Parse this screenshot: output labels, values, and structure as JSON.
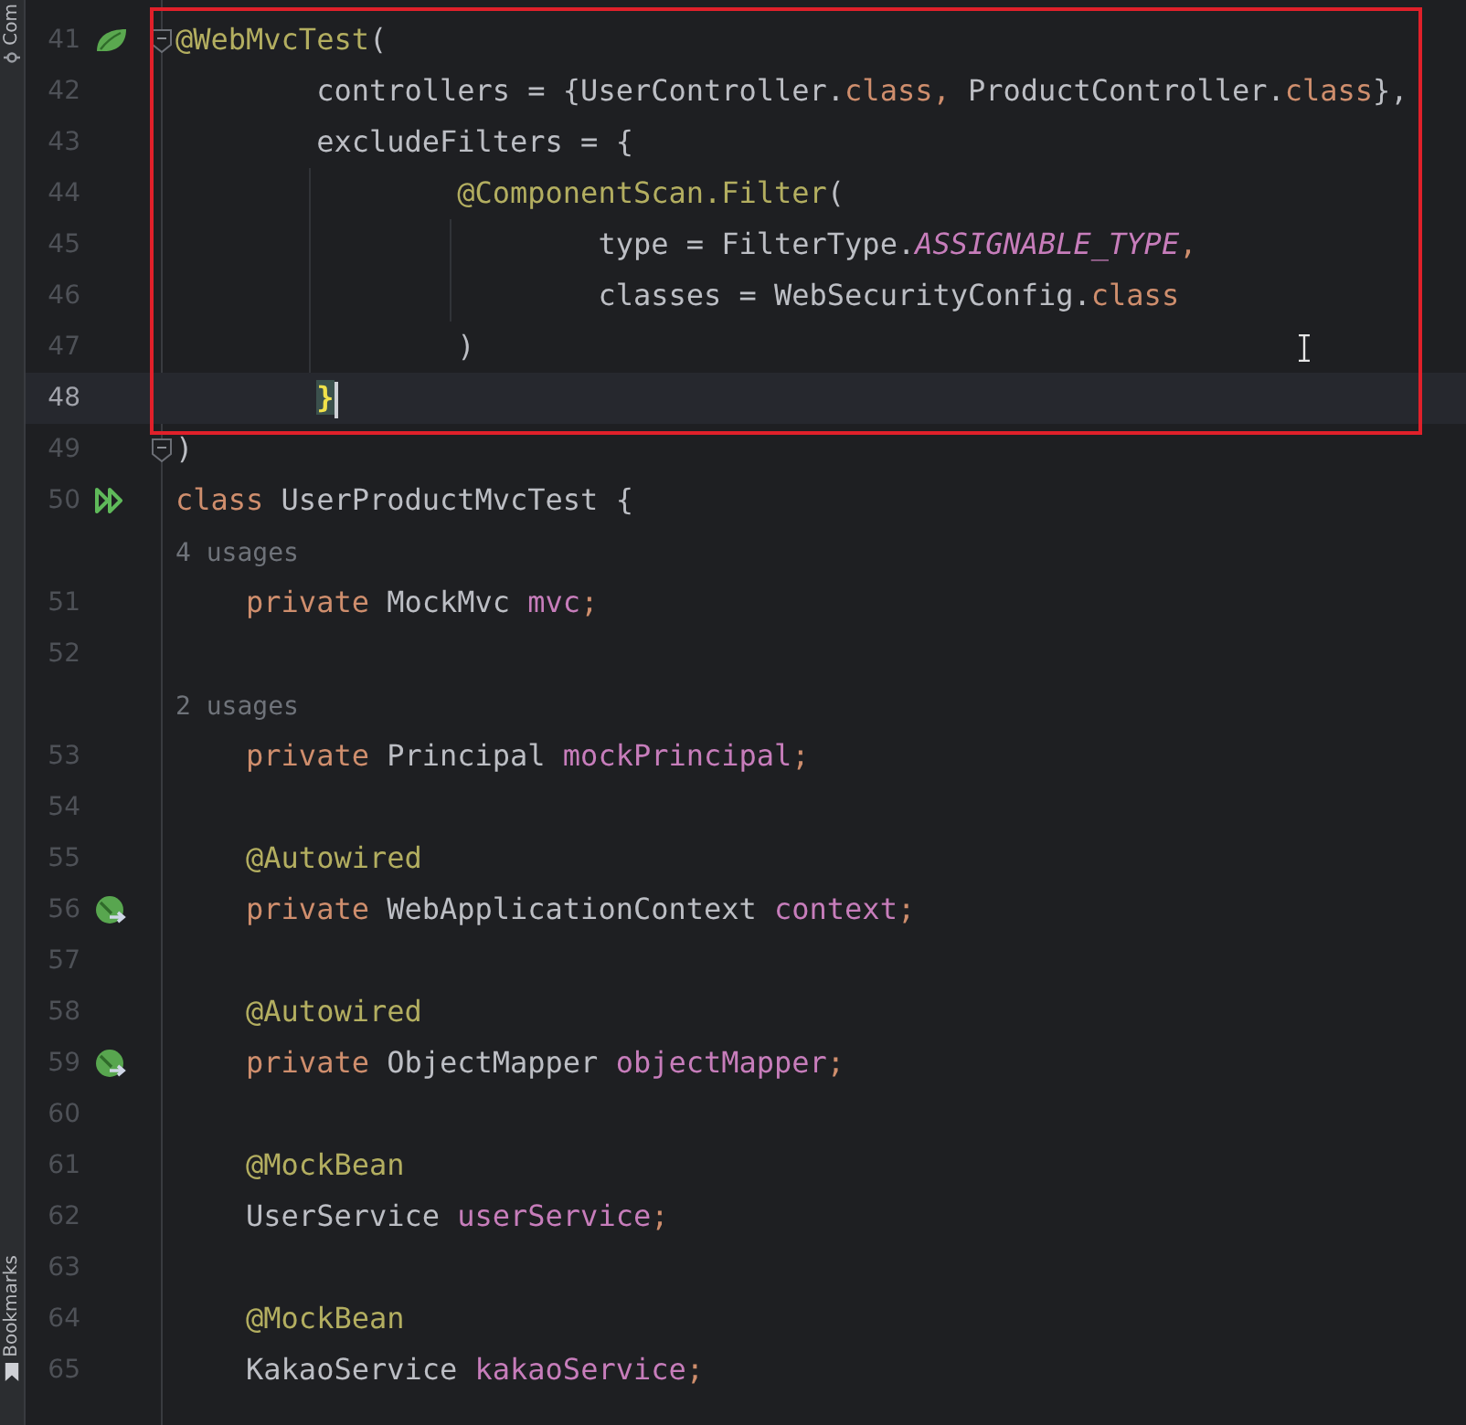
{
  "side_strip": {
    "tabs": [
      {
        "label": "Com"
      },
      {
        "label": "Bookmarks"
      }
    ]
  },
  "editor": {
    "lines": [
      {
        "kind": "code",
        "number": "41",
        "current": false,
        "fold": true,
        "gutter_icon": {
          "kind": "leaf"
        },
        "tokens": [
          {
            "t": "@WebMvcTest",
            "kind": "annotation"
          },
          {
            "t": "(",
            "kind": "plain"
          }
        ]
      },
      {
        "kind": "code",
        "number": "42",
        "current": false,
        "fold": false,
        "tokens": [
          {
            "t": "        controllers = {UserController.",
            "kind": "plain"
          },
          {
            "t": "class",
            "kind": "keyword"
          },
          {
            "t": ", ",
            "kind": "keyword"
          },
          {
            "t": "ProductController.",
            "kind": "plain"
          },
          {
            "t": "class",
            "kind": "keyword"
          },
          {
            "t": "},",
            "kind": "plain"
          }
        ]
      },
      {
        "kind": "code",
        "number": "43",
        "current": false,
        "fold": false,
        "tokens": [
          {
            "t": "        excludeFilters = ",
            "kind": "plain"
          },
          {
            "t": "{",
            "kind": "brace"
          }
        ]
      },
      {
        "kind": "code",
        "number": "44",
        "current": false,
        "fold": false,
        "tokens": [
          {
            "t": "                @ComponentScan.Filter",
            "kind": "annotation"
          },
          {
            "t": "(",
            "kind": "plain"
          }
        ]
      },
      {
        "kind": "code",
        "number": "45",
        "current": false,
        "fold": false,
        "tokens": [
          {
            "t": "                        type = FilterType.",
            "kind": "plain"
          },
          {
            "t": "ASSIGNABLE_TYPE",
            "kind": "constant"
          },
          {
            "t": ",",
            "kind": "keyword"
          }
        ]
      },
      {
        "kind": "code",
        "number": "46",
        "current": false,
        "fold": false,
        "tokens": [
          {
            "t": "                        classes = WebSecurityConfig.",
            "kind": "plain"
          },
          {
            "t": "class",
            "kind": "keyword"
          }
        ]
      },
      {
        "kind": "code",
        "number": "47",
        "current": false,
        "fold": false,
        "tokens": [
          {
            "t": "                )",
            "kind": "plain"
          }
        ]
      },
      {
        "kind": "code",
        "number": "48",
        "current": true,
        "fold": false,
        "tokens": [
          {
            "t": "        }",
            "kind": "brace-match"
          }
        ]
      },
      {
        "kind": "code",
        "number": "49",
        "current": false,
        "fold": true,
        "tokens": [
          {
            "t": ")",
            "kind": "plain"
          }
        ]
      },
      {
        "kind": "code",
        "number": "50",
        "current": false,
        "fold": false,
        "gutter_icon": {
          "kind": "run"
        },
        "tokens": [
          {
            "t": "class ",
            "kind": "keyword"
          },
          {
            "t": "UserProductMvcTest {",
            "kind": "plain"
          }
        ]
      },
      {
        "kind": "hint",
        "text": "4 usages"
      },
      {
        "kind": "code",
        "number": "51",
        "current": false,
        "fold": false,
        "tokens": [
          {
            "t": "    private ",
            "kind": "keyword"
          },
          {
            "t": "MockMvc ",
            "kind": "plain"
          },
          {
            "t": "mvc",
            "kind": "field"
          },
          {
            "t": ";",
            "kind": "keyword"
          }
        ]
      },
      {
        "kind": "code",
        "number": "52",
        "current": false,
        "fold": false
      },
      {
        "kind": "hint",
        "text": "2 usages"
      },
      {
        "kind": "code",
        "number": "53",
        "current": false,
        "fold": false,
        "tokens": [
          {
            "t": "    private ",
            "kind": "keyword"
          },
          {
            "t": "Principal ",
            "kind": "plain"
          },
          {
            "t": "mockPrincipal",
            "kind": "field"
          },
          {
            "t": ";",
            "kind": "keyword"
          }
        ]
      },
      {
        "kind": "code",
        "number": "54",
        "current": false,
        "fold": false
      },
      {
        "kind": "code",
        "number": "55",
        "current": false,
        "fold": false,
        "tokens": [
          {
            "t": "    @Autowired",
            "kind": "annotation"
          }
        ]
      },
      {
        "kind": "code",
        "number": "56",
        "current": false,
        "fold": false,
        "gutter_icon": {
          "kind": "leaf-arrow"
        },
        "tokens": [
          {
            "t": "    private ",
            "kind": "keyword"
          },
          {
            "t": "WebApplicationContext ",
            "kind": "plain"
          },
          {
            "t": "context",
            "kind": "field"
          },
          {
            "t": ";",
            "kind": "keyword"
          }
        ]
      },
      {
        "kind": "code",
        "number": "57",
        "current": false,
        "fold": false
      },
      {
        "kind": "code",
        "number": "58",
        "current": false,
        "fold": false,
        "tokens": [
          {
            "t": "    @Autowired",
            "kind": "annotation"
          }
        ]
      },
      {
        "kind": "code",
        "number": "59",
        "current": false,
        "fold": false,
        "gutter_icon": {
          "kind": "leaf-arrow"
        },
        "tokens": [
          {
            "t": "    private ",
            "kind": "keyword"
          },
          {
            "t": "ObjectMapper ",
            "kind": "plain"
          },
          {
            "t": "objectMapper",
            "kind": "field"
          },
          {
            "t": ";",
            "kind": "keyword"
          }
        ]
      },
      {
        "kind": "code",
        "number": "60",
        "current": false,
        "fold": false
      },
      {
        "kind": "code",
        "number": "61",
        "current": false,
        "fold": false,
        "tokens": [
          {
            "t": "    @MockBean",
            "kind": "annotation"
          }
        ]
      },
      {
        "kind": "code",
        "number": "62",
        "current": false,
        "fold": false,
        "tokens": [
          {
            "t": "    UserService ",
            "kind": "plain"
          },
          {
            "t": "userService",
            "kind": "field"
          },
          {
            "t": ";",
            "kind": "keyword"
          }
        ]
      },
      {
        "kind": "code",
        "number": "63",
        "current": false,
        "fold": false
      },
      {
        "kind": "code",
        "number": "64",
        "current": false,
        "fold": false,
        "tokens": [
          {
            "t": "    @MockBean",
            "kind": "annotation"
          }
        ]
      },
      {
        "kind": "code",
        "number": "65",
        "current": false,
        "fold": false,
        "tokens": [
          {
            "t": "    KakaoService ",
            "kind": "plain"
          },
          {
            "t": "kakaoService",
            "kind": "field"
          },
          {
            "t": ";",
            "kind": "keyword"
          }
        ]
      }
    ]
  }
}
